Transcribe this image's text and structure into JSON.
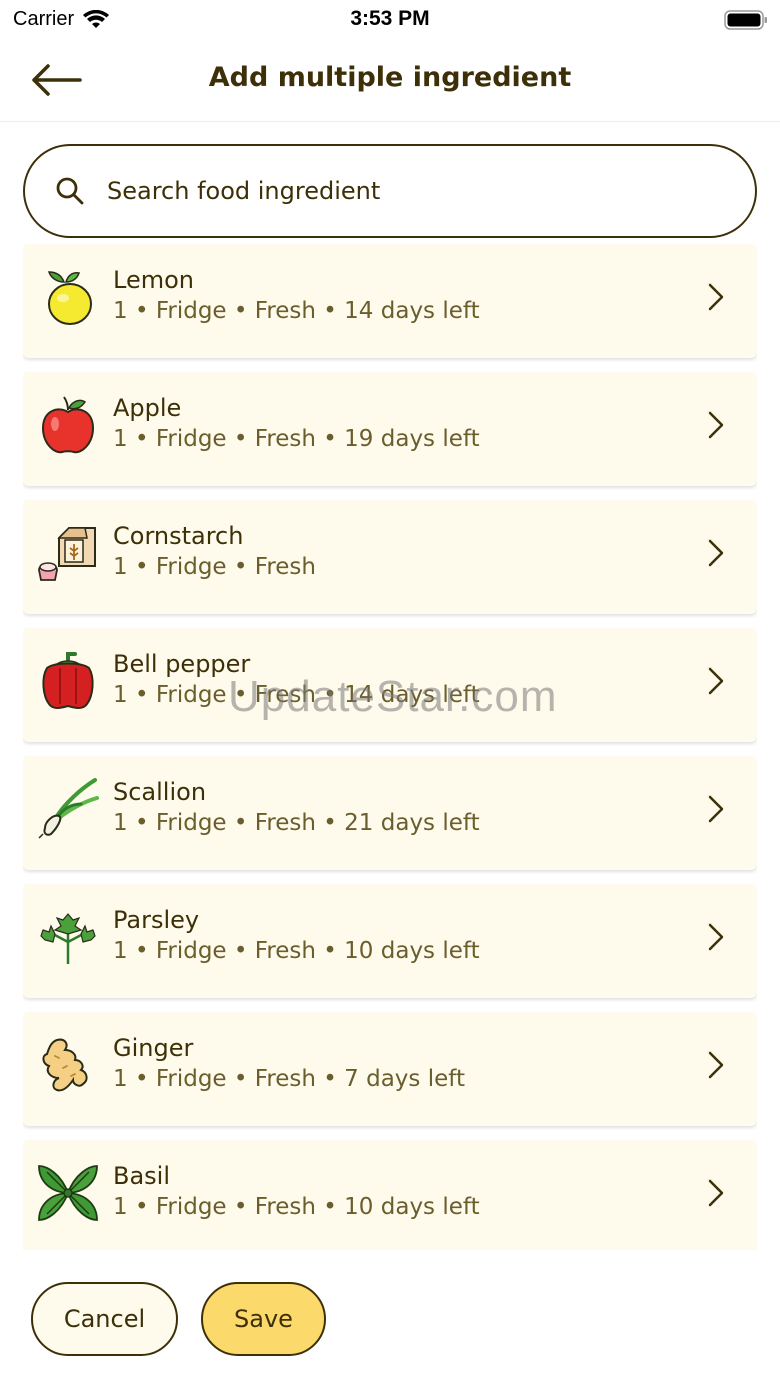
{
  "status": {
    "carrier": "Carrier",
    "time": "3:53 PM"
  },
  "header": {
    "title": "Add multiple ingredient"
  },
  "search": {
    "placeholder": "Search food ingredient"
  },
  "items": [
    {
      "name": "Lemon",
      "meta": "1 • Fridge • Fresh • 14 days left",
      "icon": "lemon-icon"
    },
    {
      "name": "Apple",
      "meta": "1 • Fridge • Fresh • 19 days left",
      "icon": "apple-icon"
    },
    {
      "name": "Cornstarch",
      "meta": "1 • Fridge • Fresh",
      "icon": "cornstarch-icon"
    },
    {
      "name": "Bell pepper",
      "meta": "1 • Fridge • Fresh • 14 days left",
      "icon": "bell-pepper-icon"
    },
    {
      "name": "Scallion",
      "meta": "1 • Fridge • Fresh • 21 days left",
      "icon": "scallion-icon"
    },
    {
      "name": "Parsley",
      "meta": "1 • Fridge • Fresh • 10 days left",
      "icon": "parsley-icon"
    },
    {
      "name": "Ginger",
      "meta": "1 • Fridge • Fresh • 7 days left",
      "icon": "ginger-icon"
    },
    {
      "name": "Basil",
      "meta": "1 • Fridge • Fresh • 10 days left",
      "icon": "basil-icon"
    }
  ],
  "footer": {
    "cancel_label": "Cancel",
    "save_label": "Save"
  },
  "watermark": "UpdateStar.com",
  "colors": {
    "text": "#3d3008",
    "row_bg": "#fefbec",
    "save_bg": "#fcd96b"
  }
}
